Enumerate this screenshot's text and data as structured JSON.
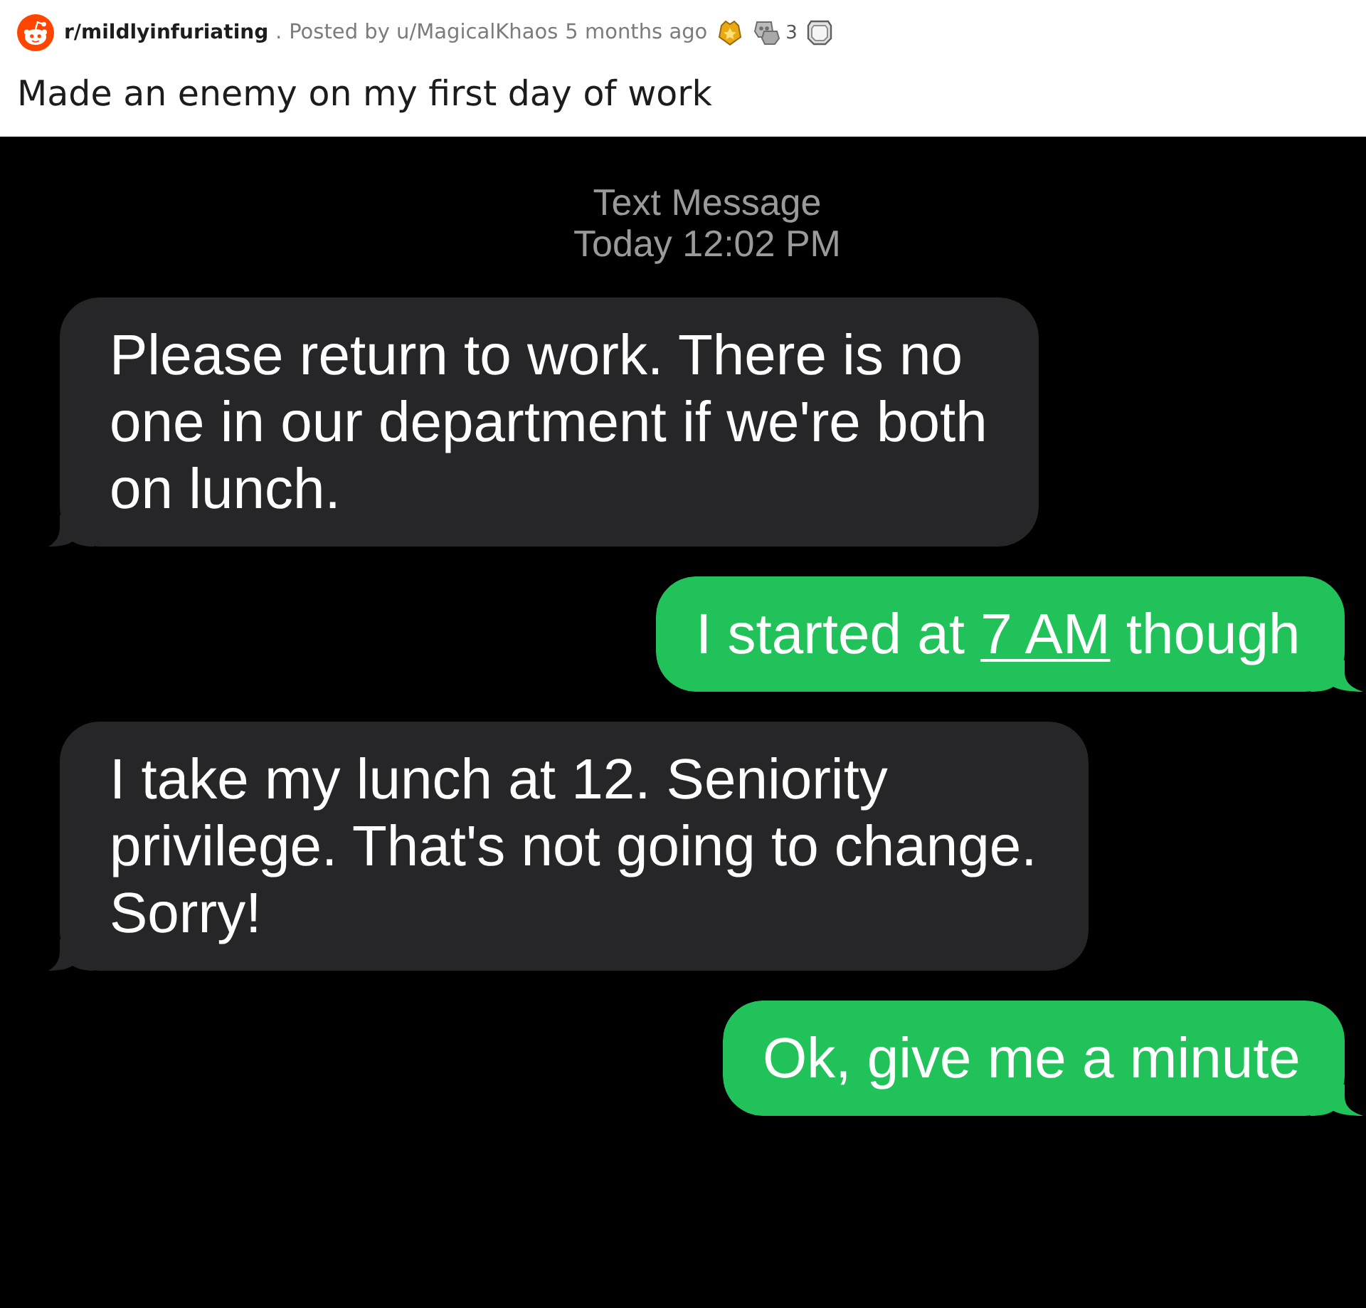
{
  "post": {
    "subreddit": "r/mildlyinfuriating",
    "separator": ".",
    "byline": "Posted by u/MagicalKhaos",
    "time": "5 months ago",
    "awards": [
      {
        "kind": "crest"
      },
      {
        "kind": "badge",
        "count": "3"
      },
      {
        "kind": "coin"
      }
    ],
    "title": "Made an enemy on my first day of work"
  },
  "conversation": {
    "service": "Text Message",
    "timestamp": "Today 12:02 PM",
    "messages": [
      {
        "kind": "received",
        "parts": [
          {
            "kind": "text",
            "text": "Please return to work. There is no one in our department if we're both on lunch."
          }
        ]
      },
      {
        "kind": "sent",
        "parts": [
          {
            "kind": "text",
            "text": "I started at "
          },
          {
            "kind": "link",
            "text": "7 AM"
          },
          {
            "kind": "text",
            "text": " though"
          }
        ]
      },
      {
        "kind": "received",
        "parts": [
          {
            "kind": "text",
            "text": "I take my lunch at 12. Seniority privilege. That's not going to change. Sorry!"
          }
        ]
      },
      {
        "kind": "sent",
        "parts": [
          {
            "kind": "text",
            "text": "Ok, give me a minute"
          }
        ]
      }
    ]
  }
}
